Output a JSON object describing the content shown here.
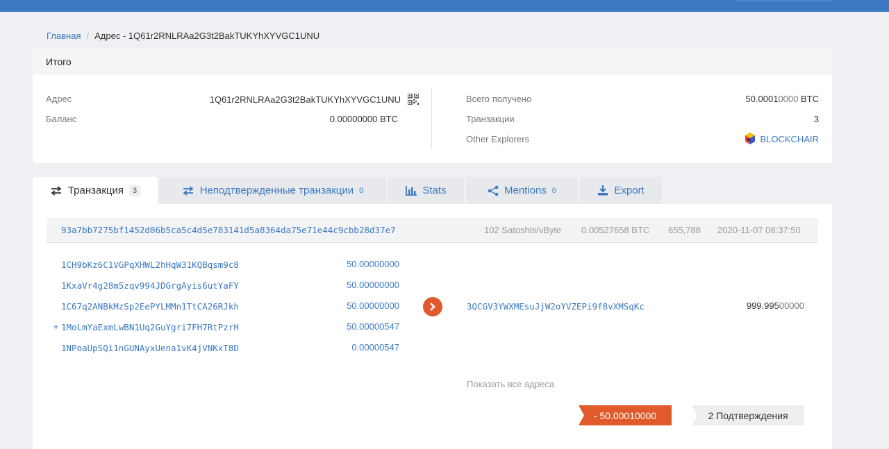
{
  "breadcrumb": {
    "home": "Главная",
    "current": "Адрес - 1Q61r2RNLRAa2G3t2BakTUKYhXYVGC1UNU"
  },
  "summary": {
    "title": "Итого",
    "address_label": "Адрес",
    "address_value": "1Q61r2RNLRAa2G3t2BakTUKYhXYVGC1UNU",
    "balance_label": "Баланс",
    "balance_main": "0.00000000",
    "balance_unit": "BTC",
    "received_label": "Всего получено",
    "received_main": "50.0001",
    "received_dim": "0000",
    "received_unit": "BTC",
    "tx_label": "Транзакции",
    "tx_value": "3",
    "explorers_label": "Other Explorers",
    "explorer_link": "BLOCKCHAIR"
  },
  "tabs": [
    {
      "label": "Транзакция",
      "count": "3",
      "icon": "exchange-icon"
    },
    {
      "label": "Неподтвержденные транзакции",
      "count": "0",
      "icon": "exchange-icon"
    },
    {
      "label": "Stats",
      "count": "",
      "icon": "bar-chart-icon"
    },
    {
      "label": "Mentions",
      "count": "0",
      "icon": "share-icon"
    },
    {
      "label": "Export",
      "count": "",
      "icon": "download-icon"
    }
  ],
  "transaction": {
    "hash": "93a7bb7275bf1452d06b5ca5c4d5e783141d5a8364da75e71e44c9cbb28d37e7",
    "fee_rate": "102 Satoshis/vByte",
    "fee": "0.00527658 BTC",
    "block": "655,788",
    "time": "2020-11-07 08:37:50",
    "inputs": [
      {
        "address": "1CH9bKz6C1VGPqXHWL2hHqW31KQBqsm9c8",
        "amount": "50.00000000"
      },
      {
        "address": "1KxaVr4g28m5zqv994JDGrgAyis6utYaFY",
        "amount": "50.00000000"
      },
      {
        "address": "1C67q2ANBkMzSp2EePYLMMn1TtCA26RJkh",
        "amount": "50.00000000"
      },
      {
        "address": "1MoLmYaExmLwBN1Uq2GuYgri7FH7RtPzrH",
        "amount": "50.00000547"
      },
      {
        "address": "1NPoaUpSQi1nGUNAyxUena1vK4jVNKxT8D",
        "amount": "0.00000547"
      }
    ],
    "plus_marker": "+",
    "output_address": "3QCGV3YWXMEsuJjW2oYVZEPi9f8vXMSqKc",
    "output_main": "999.995",
    "output_dim": "00000",
    "show_all": "Показать все адреса",
    "net_amount": "- 50.00010000",
    "confirmations": "2 Подтверждения"
  },
  "colors": {
    "accent": "#3b78c2",
    "negative": "#e05a2b",
    "topbar": "#3b78c2"
  }
}
